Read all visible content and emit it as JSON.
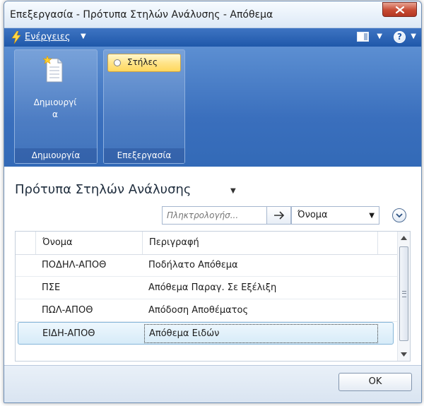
{
  "window": {
    "title": "Επεξεργασία - Πρότυπα Στηλών Ανάλυσης - Απόθεμα"
  },
  "actionbar": {
    "actions_label": "Ενέργειες",
    "help_symbol": "?"
  },
  "ribbon": {
    "groups": [
      {
        "label": "Δημιουργία",
        "button_label_line1": "Δημιουργί",
        "button_label_line2": "α"
      },
      {
        "label": "Επεξεργασία",
        "button_label": "Στήλες"
      }
    ]
  },
  "page": {
    "title": "Πρότυπα Στηλών Ανάλυσης"
  },
  "search": {
    "placeholder": "Πληκτρολογήσ...",
    "field": "Όνομα"
  },
  "table": {
    "columns": [
      "Όνομα",
      "Περιγραφή"
    ],
    "rows": [
      {
        "name": "ΠΟΔΗΛ-ΑΠΟΘ",
        "description": "Ποδήλατο Απόθεμα",
        "selected": false
      },
      {
        "name": "ΠΣΕ",
        "description": "Απόθεμα Παραγ. Σε Εξέλιξη",
        "selected": false
      },
      {
        "name": "ΠΩΛ-ΑΠΟΘ",
        "description": "Απόδοση Αποθέματος",
        "selected": false
      },
      {
        "name": "ΕΙΔΗ-ΑΠΟΘ",
        "description": "Απόθεμα Ειδών",
        "selected": true
      }
    ]
  },
  "footer": {
    "ok_label": "OK"
  },
  "icons": {
    "actions": "lightning-bolt-icon",
    "layout": "layout-icon",
    "help": "help-icon",
    "create": "new-document-icon",
    "expand": "chevron-down-circle-icon",
    "close": "close-icon"
  },
  "colors": {
    "actionbar": "#1f58aa",
    "ribbon": "#3a6fbd",
    "selected_row": "#d6ebf8",
    "highlight_button": "#ffd75c"
  }
}
